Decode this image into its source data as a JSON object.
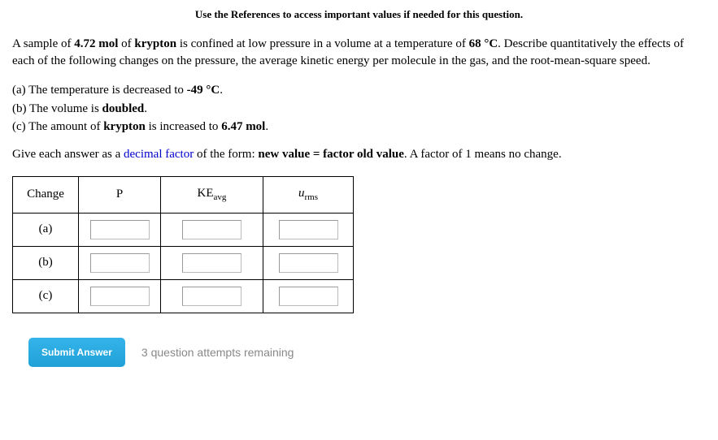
{
  "instruction": "Use the References to access important values if needed for this question.",
  "problem": {
    "pre": "A sample of ",
    "mol": "4.72 mol",
    "of": " of ",
    "gas": "krypton",
    "mid": " is confined at low pressure in a volume at a temperature of ",
    "temp": "68 °C",
    "post": ". Describe quantitatively the effects of each of the following changes on the pressure, the average kinetic energy per molecule in the gas, and the root-mean-square speed."
  },
  "parts": {
    "a_pre": "(a) The temperature is decreased to ",
    "a_val": "-49 °C",
    "a_post": ".",
    "b_pre": "(b) The volume is ",
    "b_val": "doubled",
    "b_post": ".",
    "c_pre": "(c) The amount of ",
    "c_gas": "krypton",
    "c_mid": " is increased to ",
    "c_val": "6.47 mol",
    "c_post": "."
  },
  "hint": {
    "pre": "Give each answer as a ",
    "df": "decimal factor",
    "mid": " of the form: ",
    "form": "new value = factor old value",
    "post": ".   A factor of 1 means no change."
  },
  "table": {
    "h_change": "Change",
    "h_p": "P",
    "h_ke_pre": "KE",
    "h_ke_sub": "avg",
    "h_u_pre": "u",
    "h_u_sub": "rms",
    "rows": [
      "(a)",
      "(b)",
      "(c)"
    ]
  },
  "submit": "Submit Answer",
  "attempts": "3 question attempts remaining"
}
